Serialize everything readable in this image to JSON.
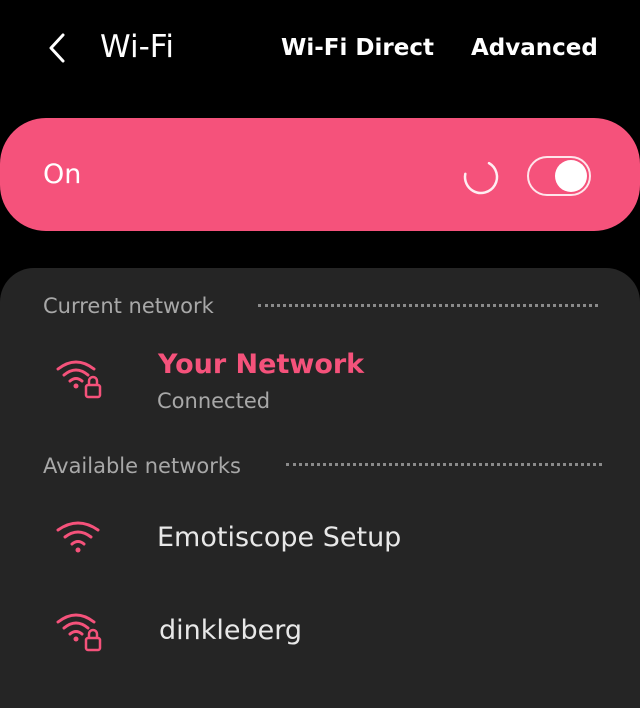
{
  "header": {
    "title": "Wi-Fi",
    "wifi_direct_label": "Wi-Fi Direct",
    "advanced_label": "Advanced",
    "back_icon": "chevron-left-icon"
  },
  "master_toggle": {
    "label": "On",
    "state": true,
    "scanning": true
  },
  "current_network": {
    "section_title": "Current network",
    "name": "Your Network",
    "status": "Connected",
    "secured": true
  },
  "available_networks": {
    "section_title": "Available networks",
    "items": [
      {
        "name": "Emotiscope Setup",
        "secured": false
      },
      {
        "name": "dinkleberg",
        "secured": true
      }
    ]
  },
  "colors": {
    "accent": "#f5527b",
    "background": "#000000",
    "panel": "#252525",
    "secondary_text": "#a8a8a8"
  }
}
